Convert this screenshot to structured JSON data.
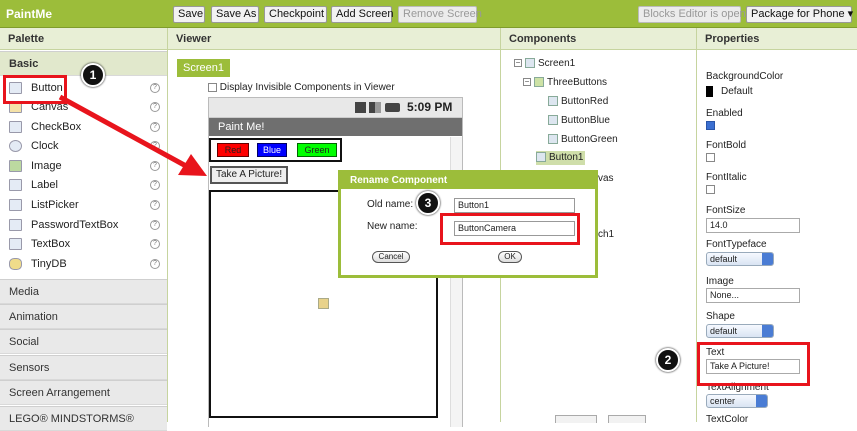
{
  "app": {
    "title": "PaintMe"
  },
  "toolbar": {
    "save": "Save",
    "save_as": "Save As",
    "checkpoint": "Checkpoint",
    "add_screen": "Add Screen",
    "remove_screen": "Remove Screen",
    "blocks_editor": "Blocks Editor is open",
    "package": "Package for Phone ▾"
  },
  "palette": {
    "header": "Palette",
    "basic": "Basic",
    "items": [
      {
        "label": "Button",
        "icon": "button-icon"
      },
      {
        "label": "Canvas",
        "icon": "canvas-icon"
      },
      {
        "label": "CheckBox",
        "icon": "checkbox-icon"
      },
      {
        "label": "Clock",
        "icon": "clock-icon"
      },
      {
        "label": "Image",
        "icon": "image-icon"
      },
      {
        "label": "Label",
        "icon": "label-icon"
      },
      {
        "label": "ListPicker",
        "icon": "listpicker-icon"
      },
      {
        "label": "PasswordTextBox",
        "icon": "password-icon"
      },
      {
        "label": "TextBox",
        "icon": "textbox-icon"
      },
      {
        "label": "TinyDB",
        "icon": "database-icon"
      }
    ],
    "sections": [
      "Media",
      "Animation",
      "Social",
      "Sensors",
      "Screen Arrangement",
      "LEGO® MINDSTORMS®"
    ],
    "help_glyph": "?"
  },
  "viewer": {
    "header": "Viewer",
    "screen_tab": "Screen1",
    "invisible_label": "Display Invisible Components in Viewer",
    "time": "5:09 PM",
    "app_title": "Paint Me!",
    "buttons": [
      "Red",
      "Blue",
      "Green"
    ],
    "picture_button": "Take A Picture!"
  },
  "components": {
    "header": "Components",
    "tree": [
      {
        "label": "Screen1",
        "toggle": "−"
      },
      {
        "label": "ThreeButtons",
        "toggle": "−"
      },
      {
        "label": "ButtonRed"
      },
      {
        "label": "ButtonBlue"
      },
      {
        "label": "ButtonGreen"
      },
      {
        "label": "Button1"
      },
      {
        "label": "vas"
      },
      {
        "label": "ch1"
      }
    ]
  },
  "properties": {
    "header": "Properties",
    "background_color_label": "BackgroundColor",
    "background_color_value": "Default",
    "enabled_label": "Enabled",
    "fontbold_label": "FontBold",
    "fontitalic_label": "FontItalic",
    "fontsize_label": "FontSize",
    "fontsize_value": "14.0",
    "fonttypeface_label": "FontTypeface",
    "fonttypeface_value": "default",
    "image_label": "Image",
    "image_value": "None...",
    "shape_label": "Shape",
    "shape_value": "default",
    "text_label": "Text",
    "text_value": "Take A Picture!",
    "textalignment_label": "TextAlignment",
    "textalignment_value": "center",
    "textcolor_label": "TextColor"
  },
  "dialog": {
    "title": "Rename Component",
    "old_label": "Old name:",
    "old_value": "Button1",
    "new_label": "New name:",
    "new_value": "ButtonCamera",
    "cancel": "Cancel",
    "ok": "OK"
  },
  "callouts": [
    "1",
    "2",
    "3"
  ],
  "colors": {
    "brand": "#9cbd3a",
    "highlight": "#e8141c"
  }
}
